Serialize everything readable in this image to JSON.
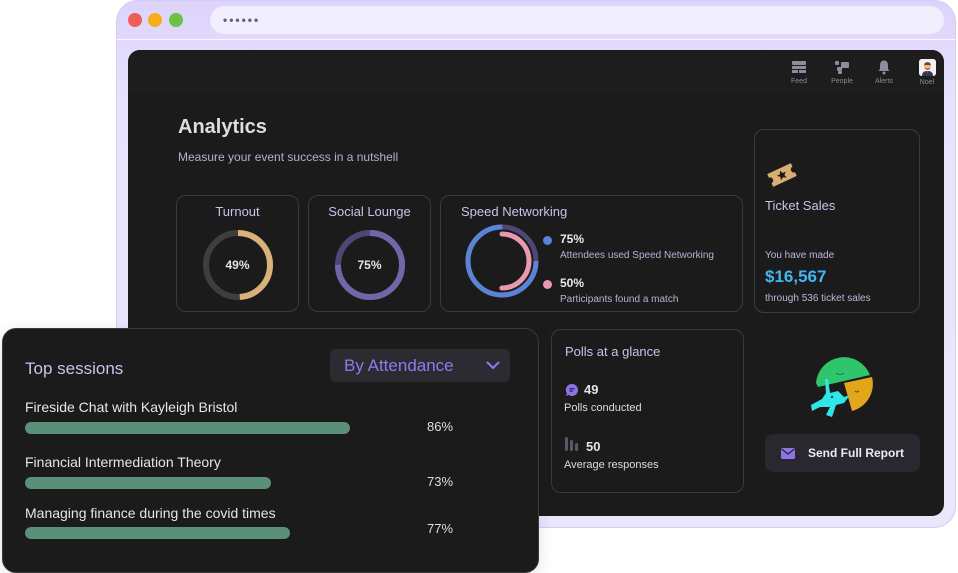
{
  "browser": {
    "address_dots": "••••••"
  },
  "header": {
    "nav": [
      {
        "label": "Feed",
        "icon": "feed-icon"
      },
      {
        "label": "People",
        "icon": "people-icon"
      },
      {
        "label": "Alerts",
        "icon": "bell-icon"
      },
      {
        "label": "Noel",
        "icon": "avatar"
      }
    ]
  },
  "page": {
    "title": "Analytics",
    "subtitle": "Measure your event success in a nutshell"
  },
  "turnout": {
    "title": "Turnout",
    "label": "49%",
    "value": 0.49,
    "color": "#d9b27a",
    "track": "#3e3e40"
  },
  "social_lounge": {
    "title": "Social Lounge",
    "label": "75%",
    "value": 0.75,
    "color": "#6e68a9",
    "track": "#4d4775"
  },
  "speed_networking": {
    "title": "Speed Networking",
    "items": [
      {
        "value_label": "75%",
        "value": 0.75,
        "text": "Attendees used Speed Networking",
        "color": "#5b84d6"
      },
      {
        "value_label": "50%",
        "value": 0.5,
        "text": "Participants found a match",
        "color": "#e89aac"
      }
    ],
    "track": "#4f4773"
  },
  "ticket_sales": {
    "title": "Ticket Sales",
    "made_label": "You have made",
    "amount": "$16,567",
    "through": "through 536 ticket sales"
  },
  "polls": {
    "title": "Polls at a glance",
    "conducted_value": "49",
    "conducted_label": "Polls conducted",
    "responses_value": "50",
    "responses_label": "Average responses"
  },
  "send_report": {
    "label": "Send Full Report"
  },
  "top_sessions": {
    "title": "Top sessions",
    "sort_selected": "By Attendance",
    "sessions": [
      {
        "name": "Fireside Chat with Kayleigh Bristol",
        "pct_label": "86%",
        "value": 0.86
      },
      {
        "name": "Financial Intermediation Theory",
        "pct_label": "73%",
        "value": 0.73
      },
      {
        "name": "Managing finance during the covid times",
        "pct_label": "77%",
        "value": 0.77
      }
    ]
  }
}
